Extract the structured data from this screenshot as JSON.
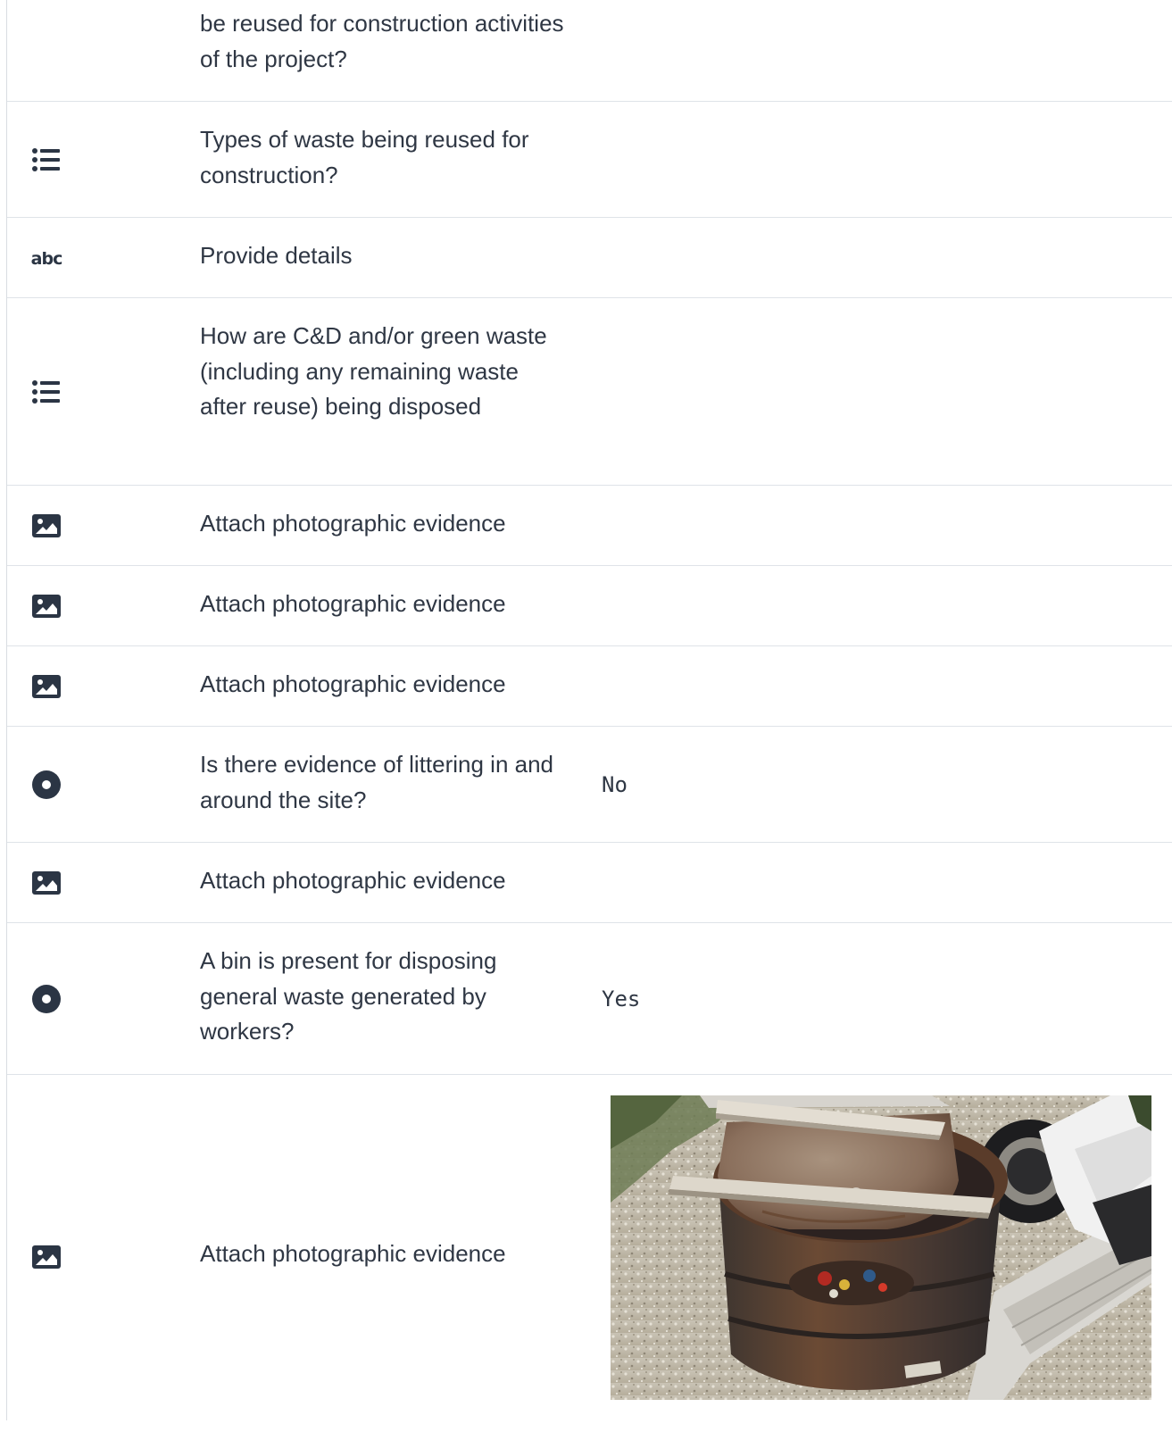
{
  "rows": [
    {
      "icon": "",
      "question": "be reused for construction activities of the project?",
      "answer": ""
    },
    {
      "icon": "list-icon",
      "question": "Types of waste being reused for construction?",
      "answer": ""
    },
    {
      "icon": "abc-text-icon",
      "icon_text": "abc",
      "question": "Provide details",
      "answer": ""
    },
    {
      "icon": "list-icon",
      "question": "How are C&D and/or green waste (including any remaining waste after reuse) being disposed",
      "answer": ""
    },
    {
      "icon": "image-icon",
      "question": "Attach photographic evidence",
      "answer": ""
    },
    {
      "icon": "image-icon",
      "question": "Attach photographic evidence",
      "answer": ""
    },
    {
      "icon": "image-icon",
      "question": "Attach photographic evidence",
      "answer": ""
    },
    {
      "icon": "radio-icon",
      "question": "Is there evidence of littering in and around the site?",
      "answer": "No"
    },
    {
      "icon": "image-icon",
      "question": "Attach photographic evidence",
      "answer": ""
    },
    {
      "icon": "radio-icon",
      "question": "A bin is present for disposing general waste generated by workers?",
      "answer": "Yes"
    },
    {
      "icon": "image-icon",
      "question": "Attach photographic evidence",
      "answer": "",
      "photo": "rusty-waste-bin-photo"
    }
  ],
  "colors": {
    "text": "#2f3744",
    "icon": "#2b3544",
    "divider": "#dfe3e8"
  }
}
